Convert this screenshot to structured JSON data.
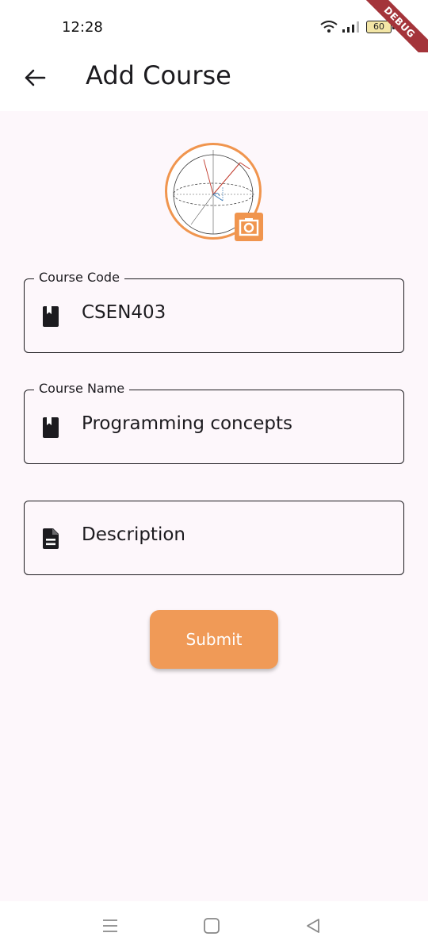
{
  "status_bar": {
    "time": "12:28",
    "battery_level": "60"
  },
  "debug_banner": "DEBUG",
  "app_bar": {
    "title": "Add Course"
  },
  "form": {
    "course_code": {
      "label": "Course Code",
      "value": "CSEN403"
    },
    "course_name": {
      "label": "Course Name",
      "value": "Programming concepts"
    },
    "description": {
      "placeholder": "Description"
    }
  },
  "submit_label": "Submit",
  "icons": {
    "back": "arrow-left-icon",
    "camera": "camera-icon",
    "course_code": "book-icon",
    "course_name": "book-icon",
    "description": "document-icon"
  },
  "colors": {
    "accent": "#f0954e",
    "button": "#f09a57",
    "background": "#fdf7fb",
    "debug": "#a4343a"
  }
}
